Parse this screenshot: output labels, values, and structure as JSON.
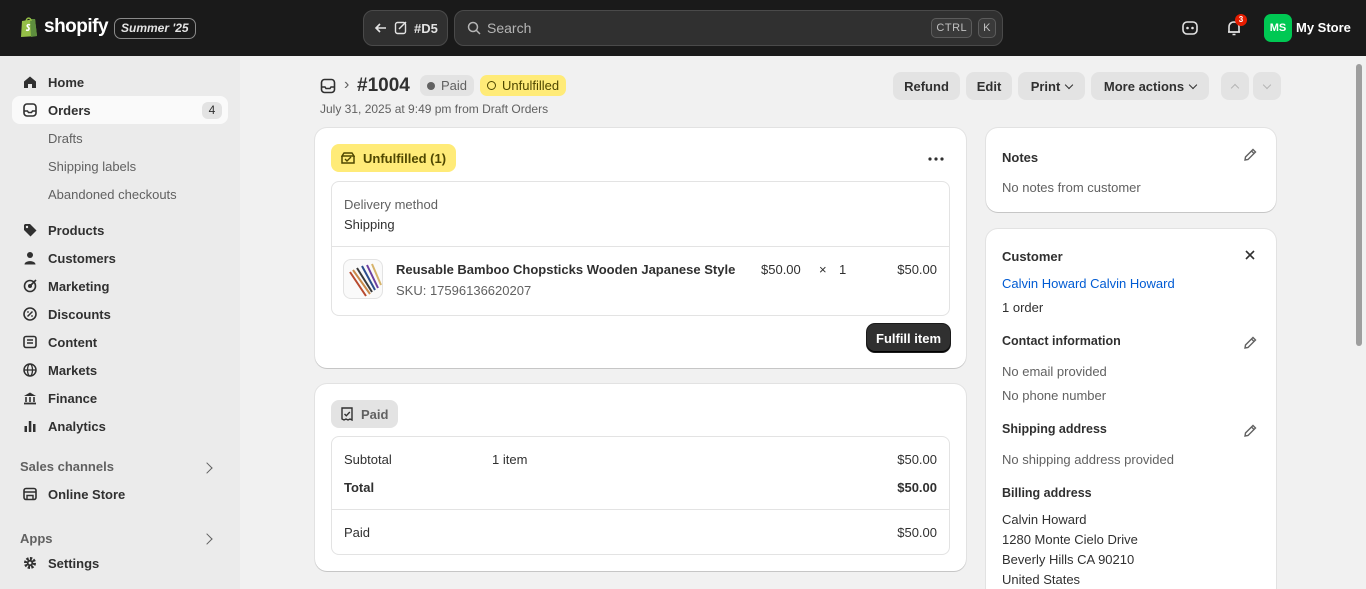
{
  "topbar": {
    "brand": "shopify",
    "edition": "Summer '25",
    "back_label": "#D5",
    "search_placeholder": "Search",
    "shortcut_keys": [
      "CTRL",
      "K"
    ],
    "notification_count": "3",
    "avatar_initials": "MS",
    "store_name": "My Store",
    "brand_color": "#95bf47",
    "avatar_color": "#00c853"
  },
  "sidebar": {
    "items": [
      {
        "label": "Home",
        "icon": "home-icon"
      },
      {
        "label": "Orders",
        "icon": "orders-icon",
        "badge": "4"
      },
      {
        "label": "Products",
        "icon": "tag-icon"
      },
      {
        "label": "Customers",
        "icon": "person-icon"
      },
      {
        "label": "Marketing",
        "icon": "target-icon"
      },
      {
        "label": "Discounts",
        "icon": "discount-icon"
      },
      {
        "label": "Content",
        "icon": "content-icon"
      },
      {
        "label": "Markets",
        "icon": "globe-icon"
      },
      {
        "label": "Finance",
        "icon": "bank-icon"
      },
      {
        "label": "Analytics",
        "icon": "chart-icon"
      }
    ],
    "order_subitems": [
      "Drafts",
      "Shipping labels",
      "Abandoned checkouts"
    ],
    "sales_channels_heading": "Sales channels",
    "online_store": "Online Store",
    "apps_heading": "Apps",
    "settings": "Settings"
  },
  "header": {
    "order_number": "#1004",
    "payment_badge": "Paid",
    "fulfillment_badge": "Unfulfilled",
    "meta": "July 31, 2025 at 9:49 pm from Draft Orders",
    "actions": {
      "refund": "Refund",
      "edit": "Edit",
      "print": "Print",
      "more": "More actions"
    }
  },
  "fulfillment_card": {
    "status": "Unfulfilled (1)",
    "delivery_label": "Delivery method",
    "delivery_value": "Shipping",
    "line_item": {
      "name": "Reusable Bamboo Chopsticks Wooden Japanese Style",
      "sku": "SKU: 17596136620207",
      "price": "$50.00",
      "times": "×",
      "quantity": "1",
      "total": "$50.00"
    },
    "fulfill_button": "Fulfill item"
  },
  "payment_card": {
    "status": "Paid",
    "subtotal_label": "Subtotal",
    "subtotal_items": "1 item",
    "subtotal_value": "$50.00",
    "total_label": "Total",
    "total_value": "$50.00",
    "paid_label": "Paid",
    "paid_value": "$50.00"
  },
  "notes_card": {
    "title": "Notes",
    "body": "No notes from customer"
  },
  "customer_card": {
    "title": "Customer",
    "name": "Calvin Howard Calvin Howard",
    "orders": "1 order",
    "contact_heading": "Contact information",
    "email": "No email provided",
    "phone": "No phone number",
    "shipping_heading": "Shipping address",
    "shipping_value": "No shipping address provided",
    "billing_heading": "Billing address",
    "billing_lines": [
      "Calvin Howard",
      "1280 Monte Cielo Drive",
      "Beverly Hills CA 90210",
      "United States"
    ]
  }
}
